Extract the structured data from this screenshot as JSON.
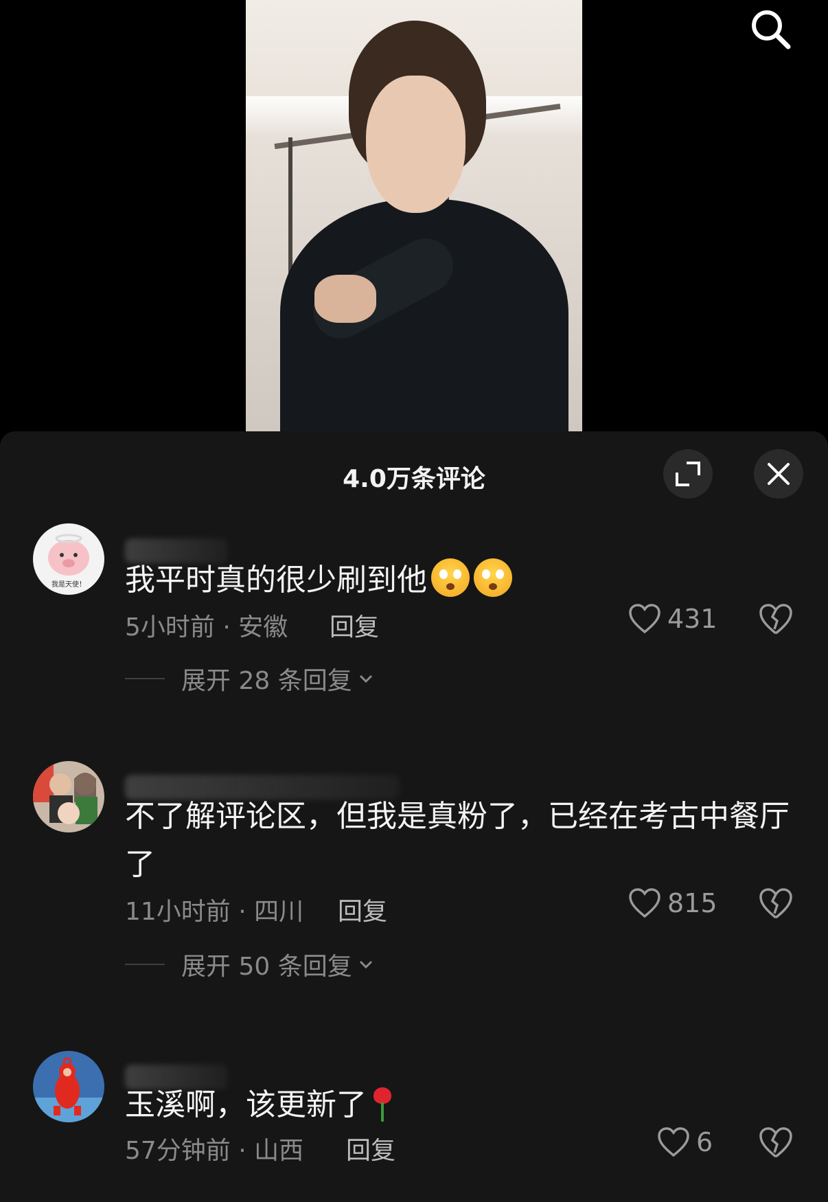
{
  "header": {
    "search_icon": "search-icon"
  },
  "sheet": {
    "title": "4.0万条评论",
    "expand_icon": "fullscreen-icon",
    "close_icon": "close-icon"
  },
  "comments": [
    {
      "text": "我平时真的很少刷到他",
      "time_location": "5小时前 · 安徽",
      "reply_label": "回复",
      "likes": "431",
      "expand_label": "展开 28 条回复",
      "avatar_text": "我是天使！"
    },
    {
      "text": "不了解评论区，但我是真粉了，已经在考古中餐厅了",
      "time_location": "11小时前 · 四川",
      "reply_label": "回复",
      "likes": "815",
      "expand_label": "展开 50 条回复"
    },
    {
      "text": "玉溪啊，该更新了",
      "time_location": "57分钟前 · 山西",
      "reply_label": "回复",
      "likes": "6"
    }
  ],
  "colors": {
    "sheet_bg": "#161616",
    "text_primary": "#f4f4f4",
    "text_secondary": "#8a8a8a"
  }
}
